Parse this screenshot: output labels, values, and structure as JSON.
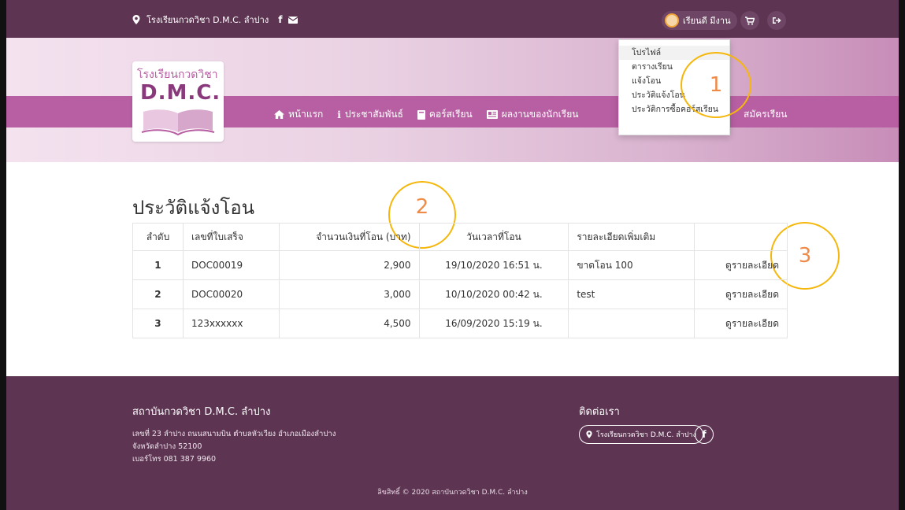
{
  "topbar": {
    "school_name": "โรงเรียนกวดวิชา D.M.C. ลำปาง",
    "facebook_icon": "facebook-icon",
    "mail_icon": "mail-icon",
    "user_name": "เรียนดี มีงาน",
    "cart_icon": "cart-icon",
    "logout_icon": "logout-icon"
  },
  "logo": {
    "line1": "โรงเรียนกวดวิชา",
    "line2": "D.M.C."
  },
  "nav": {
    "items": [
      {
        "label": "หน้าแรก",
        "icon": "home-icon"
      },
      {
        "label": "ประชาสัมพันธ์",
        "icon": "info-icon"
      },
      {
        "label": "คอร์สเรียน",
        "icon": "book-icon"
      },
      {
        "label": "ผลงานของนักเรียน",
        "icon": "newspaper-icon"
      }
    ],
    "partial_item": "สมัครเรียน"
  },
  "dropdown": {
    "items": [
      "โปรไฟล์",
      "ตารางเรียน",
      "แจ้งโอน",
      "ประวัติแจ้งโอน",
      "ประวัติการซื้อคอร์สเรียน"
    ]
  },
  "annotations": [
    "1",
    "2",
    "3"
  ],
  "page": {
    "title": "ประวัติแจ้งโอน"
  },
  "table": {
    "headers": [
      "ลำดับ",
      "เลขที่ใบเสร็จ",
      "จำนวนเงินที่โอน (บาท)",
      "วันเวลาที่โอน",
      "รายละเอียดเพิ่มเติม",
      ""
    ],
    "rows": [
      {
        "no": "1",
        "receipt": "DOC00019",
        "amount": "2,900",
        "datetime": "19/10/2020 16:51 น.",
        "detail": "ขาดโอน 100",
        "link": "ดูรายละเอียด"
      },
      {
        "no": "2",
        "receipt": "DOC00020",
        "amount": "3,000",
        "datetime": "10/10/2020 00:42 น.",
        "detail": "test",
        "link": "ดูรายละเอียด"
      },
      {
        "no": "3",
        "receipt": "123xxxxxx",
        "amount": "4,500",
        "datetime": "16/09/2020 15:19 น.",
        "detail": "",
        "link": "ดูรายละเอียด"
      }
    ]
  },
  "footer": {
    "name": "สถาบันกวดวิชา D.M.C. ลำปาง",
    "address_lines": [
      "เลขที่ 23 ลำปาง ถนนสนามบิน ตำบลหัวเวียง อำเภอเมืองลำปาง",
      "จังหวัดลำปาง 52100",
      "เบอร์โทร 081 387 9960"
    ],
    "contact_title": "ติดต่อเรา",
    "contact_pill": "โรงเรียนกวดวิชา D.M.C. ลำปาง",
    "copyright": "ลิขสิทธิ์ © 2020 สถาบันกวดวิชา D.M.C. ลำปาง"
  },
  "colors": {
    "primary": "#5d3452",
    "accent": "#b75fa2",
    "annotation": "#f5b70c"
  }
}
